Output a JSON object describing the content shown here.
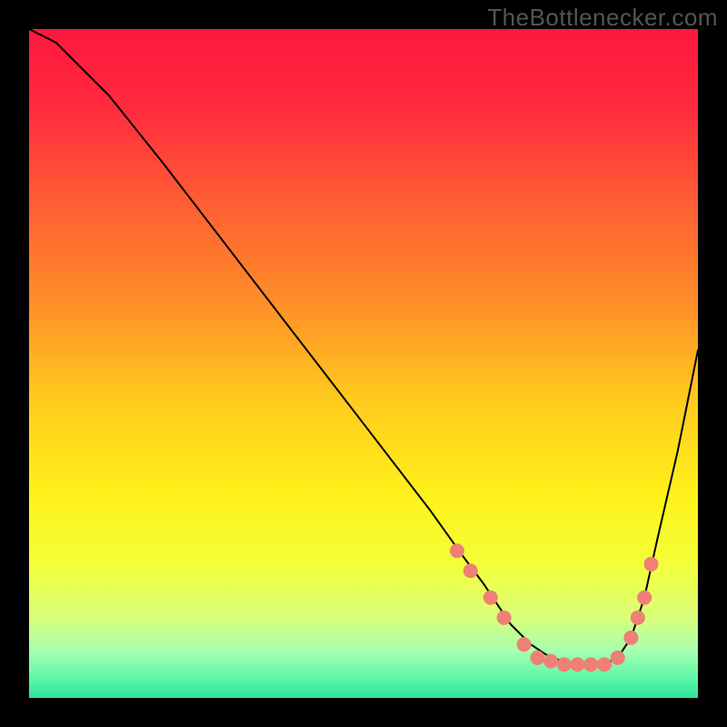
{
  "watermark": "TheBottlenecker.com",
  "chart_data": {
    "type": "line",
    "title": "",
    "xlabel": "",
    "ylabel": "",
    "xlim": [
      0,
      100
    ],
    "ylim": [
      0,
      100
    ],
    "grid": false,
    "background_gradient": {
      "stops": [
        {
          "pct": 0,
          "color": "#ff173f"
        },
        {
          "pct": 12,
          "color": "#ff2b3e"
        },
        {
          "pct": 25,
          "color": "#ff5a34"
        },
        {
          "pct": 40,
          "color": "#ff8b29"
        },
        {
          "pct": 55,
          "color": "#ffc91e"
        },
        {
          "pct": 70,
          "color": "#fff21a"
        },
        {
          "pct": 80,
          "color": "#f3ff3a"
        },
        {
          "pct": 88,
          "color": "#d8ff7a"
        },
        {
          "pct": 93,
          "color": "#a6ffb0"
        },
        {
          "pct": 97,
          "color": "#5cf7a9"
        },
        {
          "pct": 100,
          "color": "#2fe59a"
        }
      ]
    },
    "series": [
      {
        "name": "curve",
        "color": "#000000",
        "stroke_width": 2,
        "x": [
          0,
          4,
          8,
          12,
          20,
          30,
          40,
          50,
          60,
          65,
          68,
          70,
          72,
          75,
          78,
          82,
          86,
          88,
          90,
          92,
          94,
          97,
          100
        ],
        "y": [
          100,
          98,
          94,
          90,
          80,
          67,
          54,
          41,
          28,
          21,
          17,
          14,
          11,
          8,
          6,
          5,
          5,
          6,
          9,
          15,
          24,
          37,
          52
        ]
      }
    ],
    "markers": {
      "name": "highlight-points",
      "color": "#ef8075",
      "radius": 8,
      "x": [
        64,
        66,
        69,
        71,
        74,
        76,
        78,
        80,
        82,
        84,
        86,
        88,
        90,
        91,
        92,
        93
      ],
      "y": [
        22,
        19,
        15,
        12,
        8,
        6,
        5.5,
        5,
        5,
        5,
        5,
        6,
        9,
        12,
        15,
        20
      ]
    }
  }
}
